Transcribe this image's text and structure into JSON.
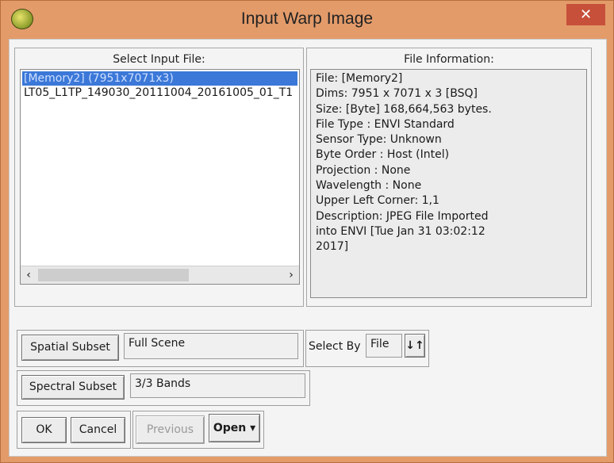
{
  "window": {
    "title": "Input Warp Image",
    "close_glyph": "✕"
  },
  "select_input": {
    "header": "Select Input File:",
    "files": [
      "[Memory2] (7951x7071x3)",
      "LT05_L1TP_149030_20111004_20161005_01_T1"
    ],
    "scroll_left": "‹",
    "scroll_right": "›"
  },
  "file_info": {
    "header": "File Information:",
    "lines": [
      "File: [Memory2]",
      "Dims: 7951 x 7071 x 3 [BSQ]",
      "Size: [Byte] 168,664,563 bytes.",
      "File Type  : ENVI Standard",
      "Sensor Type: Unknown",
      "Byte Order : Host (Intel)",
      "Projection : None",
      "Wavelength : None",
      "Upper Left Corner: 1,1",
      "Description: JPEG File Imported",
      "into ENVI [Tue Jan 31 03:02:12",
      "2017]"
    ]
  },
  "spatial_subset": {
    "button": "Spatial Subset",
    "value": "Full Scene"
  },
  "select_by": {
    "label": "Select By",
    "value": "File",
    "sort_glyph": "↓↑"
  },
  "spectral_subset": {
    "button": "Spectral Subset",
    "value": "3/3 Bands"
  },
  "actions": {
    "ok": "OK",
    "cancel": "Cancel",
    "previous": "Previous",
    "open": "Open ▾"
  },
  "colors": {
    "titlebar": "#e39b6a",
    "selection": "#3b78d8",
    "close": "#c7503a"
  }
}
